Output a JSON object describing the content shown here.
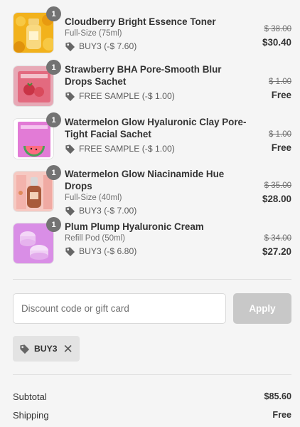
{
  "items": [
    {
      "name": "Cloudberry Bright Essence Toner",
      "variant": "Full-Size (75ml)",
      "discount": "BUY3 (-$ 7.60)",
      "original_price": "$ 38.00",
      "final_price": "$30.40",
      "quantity": "1",
      "thumb": "cloudberry-toner-image"
    },
    {
      "name": "Strawberry BHA Pore-Smooth Blur Drops Sachet",
      "variant": "",
      "discount": "FREE SAMPLE (-$ 1.00)",
      "original_price": "$ 1.00",
      "final_price": "Free",
      "quantity": "1",
      "thumb": "strawberry-sachet-image"
    },
    {
      "name": "Watermelon Glow Hyaluronic Clay Pore-Tight Facial Sachet",
      "variant": "",
      "discount": "FREE SAMPLE (-$ 1.00)",
      "original_price": "$ 1.00",
      "final_price": "Free",
      "quantity": "1",
      "thumb": "watermelon-sachet-image"
    },
    {
      "name": "Watermelon Glow Niacinamide Hue Drops",
      "variant": "Full-Size (40ml)",
      "discount": "BUY3 (-$ 7.00)",
      "original_price": "$ 35.00",
      "final_price": "$28.00",
      "quantity": "1",
      "thumb": "hue-drops-image"
    },
    {
      "name": "Plum Plump Hyaluronic Cream",
      "variant": "Refill Pod (50ml)",
      "discount": "BUY3 (-$ 6.80)",
      "original_price": "$ 34.00",
      "final_price": "$27.20",
      "quantity": "1",
      "thumb": "plum-cream-image"
    }
  ],
  "discount_form": {
    "placeholder": "Discount code or gift card",
    "value": "",
    "apply_label": "Apply"
  },
  "applied_code": {
    "code": "BUY3",
    "remove_symbol": "✕"
  },
  "summary": {
    "subtotal_label": "Subtotal",
    "subtotal_value": "$85.60",
    "shipping_label": "Shipping",
    "shipping_value": "Free"
  },
  "colors": {
    "background": "#f5f5f5",
    "qty_badge": "#737373",
    "apply_button_disabled": "#c8c8c8",
    "code_chip": "#e3e3e3"
  }
}
